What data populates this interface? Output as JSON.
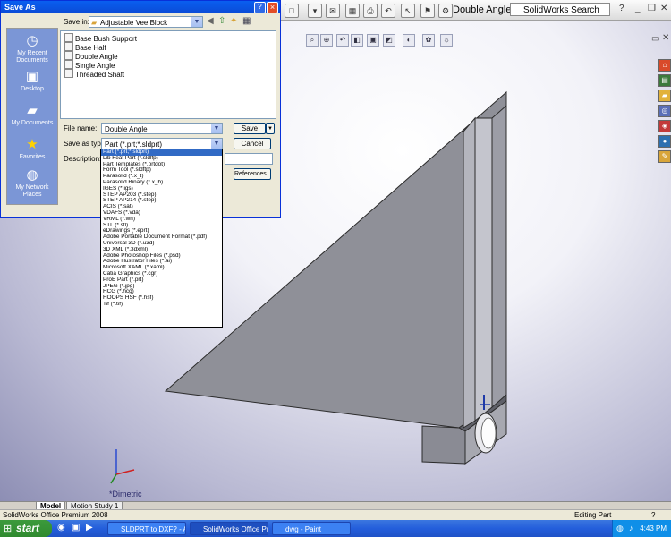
{
  "viewport": {
    "view_label": "*Dimetric"
  },
  "topbar": {
    "doc_title": "Double Angle",
    "search_placeholder": "SolidWorks Search"
  },
  "tabs": [
    {
      "label": "Model"
    },
    {
      "label": "Motion Study 1"
    }
  ],
  "status": {
    "app": "SolidWorks Office Premium 2008",
    "mode": "Editing Part"
  },
  "taskbar": {
    "start": "start",
    "buttons": [
      {
        "label": "SLDPRT to DXF? - Aut..."
      },
      {
        "label": "SolidWorks Office Pre..."
      },
      {
        "label": "dwg - Paint"
      }
    ],
    "clock": "4:43 PM"
  },
  "dialog": {
    "title": "Save As",
    "save_in_label": "Save in:",
    "save_in_value": "Adjustable Vee Block",
    "places": [
      {
        "label": "My Recent Documents",
        "icon": "recent-documents-icon"
      },
      {
        "label": "Desktop",
        "icon": "desktop-icon"
      },
      {
        "label": "My Documents",
        "icon": "my-documents-icon"
      },
      {
        "label": "Favorites",
        "icon": "favorites-icon"
      },
      {
        "label": "My Network Places",
        "icon": "network-places-icon"
      }
    ],
    "files": [
      {
        "name": "Base Bush Support"
      },
      {
        "name": "Base Half"
      },
      {
        "name": "Double Angle"
      },
      {
        "name": "Single Angle"
      },
      {
        "name": "Threaded Shaft"
      }
    ],
    "file_name_label": "File name:",
    "file_name_value": "Double Angle",
    "save_type_label": "Save as type:",
    "save_type_value": "Part (*.prt;*.sldprt)",
    "description_label": "Description:",
    "save_button": "Save",
    "cancel_button": "Cancel",
    "references_button": "References...",
    "file_types": [
      "Part (*.prt;*.sldprt)",
      "Lib Feat Part (*.sldlfp)",
      "Part Templates (*.prtdot)",
      "Form Tool (*.sldftp)",
      "Parasolid (*.x_t)",
      "Parasolid Binary (*.x_b)",
      "IGES (*.igs)",
      "STEP AP203 (*.step)",
      "STEP AP214 (*.step)",
      "ACIS (*.sat)",
      "VDAFS (*.vda)",
      "VRML (*.wrl)",
      "STL (*.stl)",
      "eDrawings (*.eprt)",
      "Adobe Portable Document Format (*.pdf)",
      "Universal 3D (*.u3d)",
      "3D XML (*.3dxml)",
      "Adobe Photoshop Files (*.psd)",
      "Adobe Illustrator Files (*.ai)",
      "Microsoft XAML (*.xaml)",
      "Catia Graphics (*.cgr)",
      "ProE Part (*.prt)",
      "JPEG (*.jpg)",
      "HCG (*.hcg)",
      "HOOPS HSF (*.hsf)",
      "Tif (*.tif)"
    ]
  }
}
